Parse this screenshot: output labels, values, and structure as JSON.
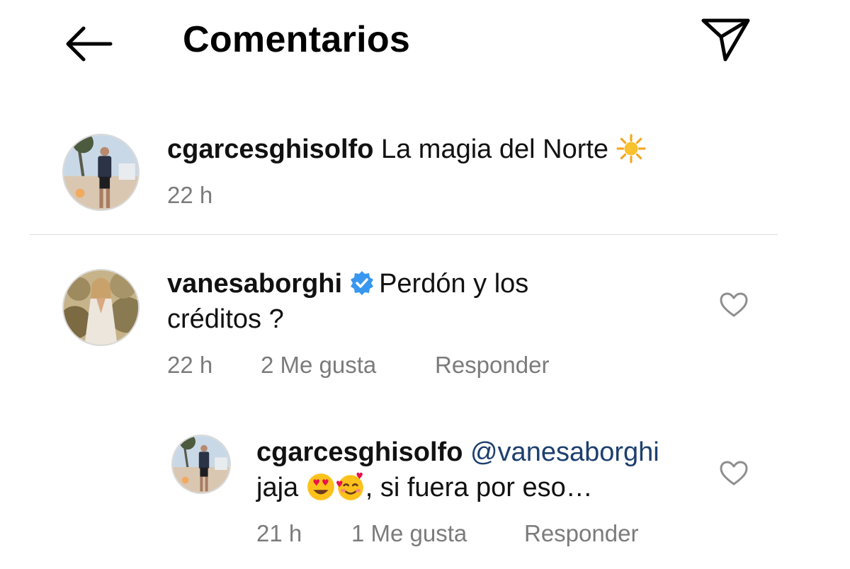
{
  "header": {
    "title": "Comentarios",
    "back_icon": "arrow-left-icon",
    "share_icon": "paper-plane-icon"
  },
  "caption": {
    "username": "cgarcesghisolfo",
    "text": "La magia del Norte",
    "emoji": "sun-emoji",
    "time": "22 h"
  },
  "comments": [
    {
      "username": "vanesaborghi",
      "verified": true,
      "text_line1": "Perdón y los",
      "text_line2": "créditos ?",
      "time": "22 h",
      "likes": "2 Me gusta",
      "reply_label": "Responder"
    }
  ],
  "replies": [
    {
      "username": "cgarcesghisolfo",
      "mention": "@vanesaborghi",
      "text_prefix": "jaja",
      "text_suffix": ", si fuera por eso…",
      "emojis": [
        "heart-eyes-emoji",
        "smiling-face-with-hearts-emoji"
      ],
      "time": "21 h",
      "likes": "1 Me gusta",
      "reply_label": "Responder"
    }
  ],
  "colors": {
    "text": "#111111",
    "muted": "#7b7b7b",
    "mention": "#1d3f6e",
    "verified": "#3897f0",
    "divider": "#dbdbdb"
  }
}
